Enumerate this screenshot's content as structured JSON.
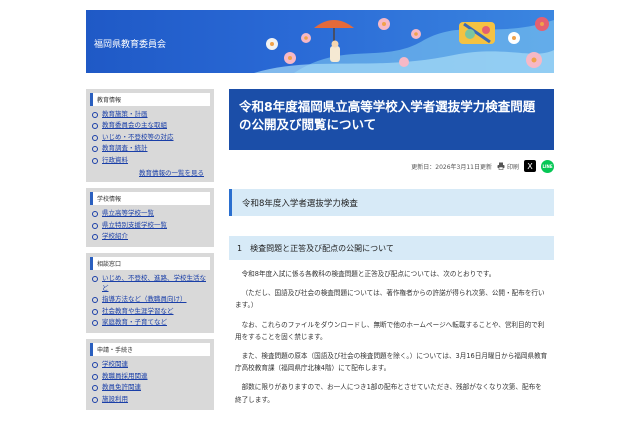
{
  "header": {
    "site_title": "福岡県教育委員会"
  },
  "sidebar": {
    "groups": [
      {
        "heading": "教育情報",
        "items": [
          "教育施策・計画",
          "教育委員会の主な取組",
          "いじめ・不登校等の対応",
          "教育調査・統計",
          "行政資料"
        ],
        "more": "教育情報の一覧を見る"
      },
      {
        "heading": "学校情報",
        "items": [
          "県立高等学校一覧",
          "県立特別支援学校一覧",
          "学校紹介"
        ]
      },
      {
        "heading": "相談窓口",
        "items": [
          "いじめ、不登校、進路、学校生活など",
          "指導方法など（教職員向け）",
          "社会教育や生涯学習など",
          "家庭教育・子育てなど"
        ]
      },
      {
        "heading": "申請・手続き",
        "items": [
          "学校関連",
          "教職員採用関連",
          "教員免許関連",
          "施設利用"
        ]
      }
    ]
  },
  "main": {
    "title": "令和8年度福岡県立高等学校入学者選抜学力検査問題の公開及び閲覧について",
    "updated": "更新日：2026年3月11日更新",
    "print_label": "印刷",
    "x_label": "X",
    "line_label": "LINE",
    "section_heading": "令和8年度入学者選抜学力検査",
    "subsection_heading": "1　検査問題と正答及び配点の公開について",
    "paragraphs": [
      "令和8年度入試に係る各教科の検査問題と正答及び配点については、次のとおりです。",
      "（ただし、国語及び社会の検査問題については、著作権者からの許諾が得られ次第、公開・配布を行います。）",
      "なお、これらのファイルをダウンロードし、無断で他のホームページへ転載することや、営利目的で利用をすることを固く禁じます。",
      "また、検査問題の原本（国語及び社会の検査問題を除く。）については、3月16日月曜日から福岡県教育庁高校教育課（福岡県庁北棟4階）にて配布します。",
      "部数に限りがありますので、お一人につき1部の配布とさせていただき、残部がなくなり次第、配布を終了します。"
    ]
  },
  "colors": {
    "title_bg": "#1b4ea8",
    "link": "#1a3fa8",
    "heading_bg": "#d7eaf7",
    "banner": "#2a6ad6"
  }
}
